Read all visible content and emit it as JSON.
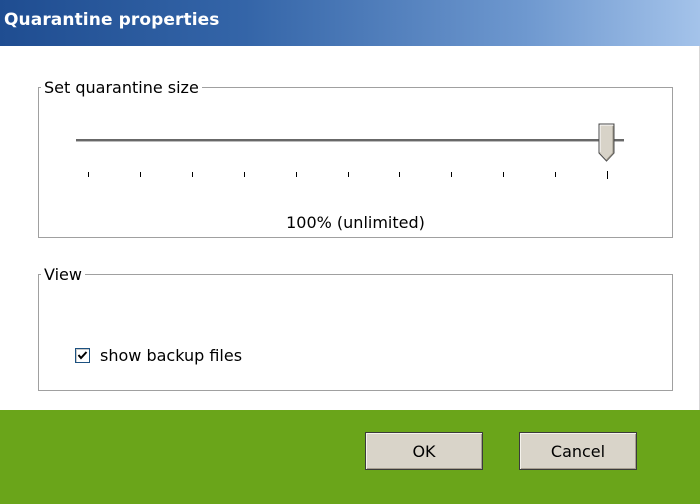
{
  "window": {
    "title": "Quarantine properties"
  },
  "size_group": {
    "legend": "Set quarantine size",
    "slider": {
      "value_percent": 100,
      "tick_count": 11,
      "value_label": "100% (unlimited)"
    }
  },
  "view_group": {
    "legend": "View",
    "show_backup": {
      "label": "show backup files",
      "checked": true
    }
  },
  "buttons": {
    "ok": "OK",
    "cancel": "Cancel"
  },
  "colors": {
    "titlebar_start": "#1f4d91",
    "titlebar_end": "#a4c3ea",
    "footer": "#6aa51a",
    "button_face": "#d9d4c9"
  }
}
